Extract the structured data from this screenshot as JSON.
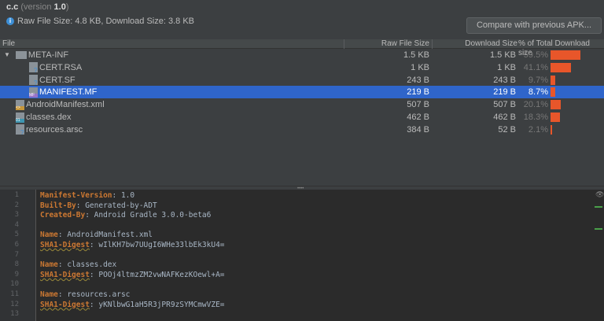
{
  "header": {
    "app": "c.c",
    "version_prefix": "(version ",
    "version": "1.0",
    "version_suffix": ")",
    "info": "Raw File Size: 4.8 KB, Download Size: 3.8 KB",
    "compare_button": "Compare with previous APK..."
  },
  "columns": [
    "File",
    "Raw File Size",
    "Download Size",
    "% of Total Download size"
  ],
  "accent": "#e8562a",
  "selection": "#2f65ca",
  "rows": [
    {
      "name": "META-INF",
      "raw": "1.5 KB",
      "dl": "1.5 KB",
      "pct": "59.5%",
      "pct_value": 59.5,
      "indent": 0,
      "icon": "folder-icon",
      "expanded": true
    },
    {
      "name": "CERT.RSA",
      "raw": "1 KB",
      "dl": "1 KB",
      "pct": "41.1%",
      "pct_value": 41.1,
      "indent": 1,
      "icon": "unknown-file-icon"
    },
    {
      "name": "CERT.SF",
      "raw": "243 B",
      "dl": "243 B",
      "pct": "9.7%",
      "pct_value": 9.7,
      "indent": 1,
      "icon": "unknown-file-icon"
    },
    {
      "name": "MANIFEST.MF",
      "raw": "219 B",
      "dl": "219 B",
      "pct": "8.7%",
      "pct_value": 8.7,
      "indent": 1,
      "icon": "manifest-file-icon",
      "selected": true
    },
    {
      "name": "AndroidManifest.xml",
      "raw": "507 B",
      "dl": "507 B",
      "pct": "20.1%",
      "pct_value": 20.1,
      "indent": 0,
      "icon": "xml-file-icon"
    },
    {
      "name": "classes.dex",
      "raw": "462 B",
      "dl": "462 B",
      "pct": "18.3%",
      "pct_value": 18.3,
      "indent": 0,
      "icon": "dex-file-icon"
    },
    {
      "name": "resources.arsc",
      "raw": "384 B",
      "dl": "52 B",
      "pct": "2.1%",
      "pct_value": 2.1,
      "indent": 0,
      "icon": "unknown-file-icon"
    }
  ],
  "editor": {
    "lines": [
      {
        "k": "Manifest-Version",
        "v": ": 1.0"
      },
      {
        "k": "Built-By",
        "v": ": Generated-by-ADT"
      },
      {
        "k": "Created-By",
        "v": ": Android Gradle 3.0.0-beta6"
      },
      {
        "k": "",
        "v": ""
      },
      {
        "k": "Name",
        "v": ": AndroidManifest.xml"
      },
      {
        "k": "SHA1-Digest",
        "v": ": wIlKH7bw7UUgI6WHe33lbEk3kU4=",
        "warn": true
      },
      {
        "k": "",
        "v": ""
      },
      {
        "k": "Name",
        "v": ": classes.dex"
      },
      {
        "k": "SHA1-Digest",
        "v": ": POOj4ltmzZM2vwNAFKezKOewl+A=",
        "warn": true
      },
      {
        "k": "",
        "v": ""
      },
      {
        "k": "Name",
        "v": ": resources.arsc"
      },
      {
        "k": "SHA1-Digest",
        "v": ": yKNlbwG1aH5R3jPR9zSYMCmwVZE=",
        "warn": true
      },
      {
        "k": "",
        "v": ""
      }
    ]
  }
}
